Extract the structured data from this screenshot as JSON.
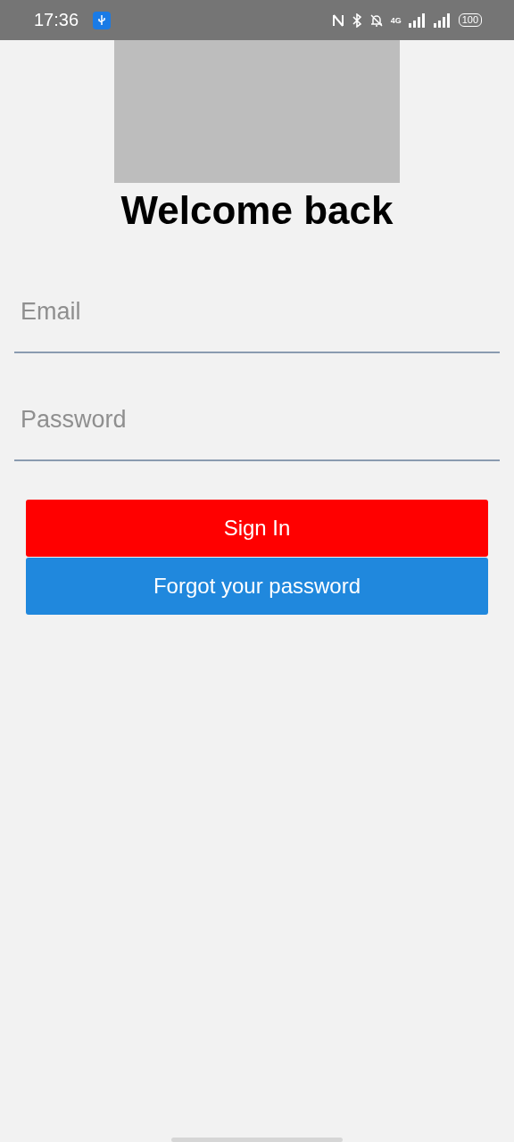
{
  "status_bar": {
    "time": "17:36",
    "network": "4G",
    "battery": "100"
  },
  "title": "Welcome back",
  "fields": [
    {
      "placeholder": "Email"
    },
    {
      "placeholder": "Password"
    }
  ],
  "buttons": [
    {
      "label": "Sign In",
      "kind": "primary"
    },
    {
      "label": "Forgot your password",
      "kind": "secondary"
    }
  ]
}
